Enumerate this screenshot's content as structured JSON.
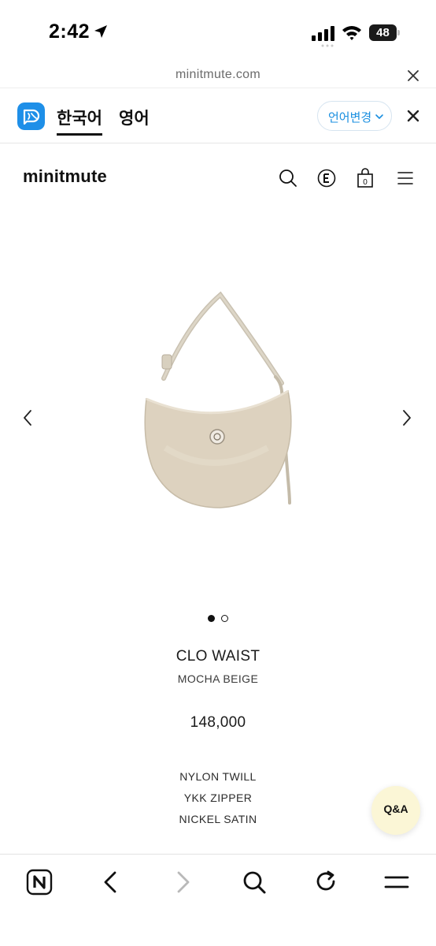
{
  "status_bar": {
    "time": "2:42",
    "battery": "48",
    "icons": [
      "location-arrow-icon",
      "cellular-signal-icon",
      "wifi-icon",
      "battery-icon"
    ]
  },
  "browser": {
    "url": "minitmute.com"
  },
  "translate_bar": {
    "tabs": [
      {
        "label": "한국어",
        "selected": true
      },
      {
        "label": "영어",
        "selected": false
      }
    ],
    "change_label": "언어변경",
    "accent_color": "#1a8fe0"
  },
  "site": {
    "brand": "minitmute",
    "bag_count": "0",
    "header_icons": [
      "search-icon",
      "e-badge-icon",
      "shopping-bag-icon",
      "hamburger-menu-icon"
    ]
  },
  "gallery": {
    "total_slides": 2,
    "active_slide": 1
  },
  "product": {
    "name": "CLO WAIST",
    "color": "MOCHA BEIGE",
    "price": "148,000",
    "specs": [
      "NYLON TWILL",
      "YKK ZIPPER",
      "NICKEL SATIN"
    ]
  },
  "qa_button": {
    "label": "Q&A",
    "color": "#fbf6d6"
  },
  "bottom_toolbar": {
    "icons": [
      "naver-n-icon",
      "back-arrow-icon",
      "forward-arrow-icon",
      "search-icon",
      "reload-icon",
      "menu-icon"
    ]
  }
}
